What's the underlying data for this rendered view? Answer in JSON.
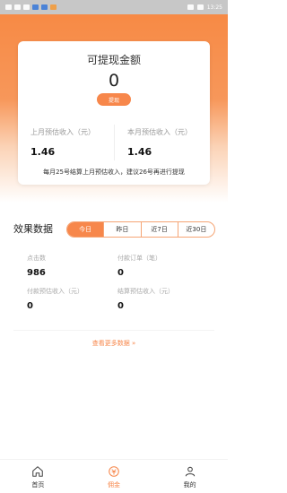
{
  "status_bar": {
    "time": "13:25"
  },
  "balance_card": {
    "title": "可提现金额",
    "amount": "0",
    "withdraw_label": "提现",
    "last_month_label": "上月预估收入（元）",
    "last_month_value": "1.46",
    "this_month_label": "本月预估收入（元）",
    "this_month_value": "1.46",
    "note": "每月25号结算上月预估收入，建议26号再进行提现"
  },
  "effect": {
    "title": "效果数据",
    "tabs": [
      "今日",
      "昨日",
      "近7日",
      "近30日"
    ],
    "active_tab": 0,
    "clicks_label": "点击数",
    "clicks_value": "986",
    "paid_orders_label": "付款订单（笔）",
    "paid_orders_value": "0",
    "paid_est_label": "付款预估收入（元）",
    "paid_est_value": "0",
    "settle_est_label": "结算预估收入（元）",
    "settle_est_value": "0",
    "more_label": "查看更多数据 »"
  },
  "tabbar": {
    "items": [
      {
        "label": "首页",
        "icon": "home-icon"
      },
      {
        "label": "佣金",
        "icon": "commission-icon"
      },
      {
        "label": "我的",
        "icon": "user-icon"
      }
    ],
    "active": 1,
    "accent": "#f7874b"
  }
}
